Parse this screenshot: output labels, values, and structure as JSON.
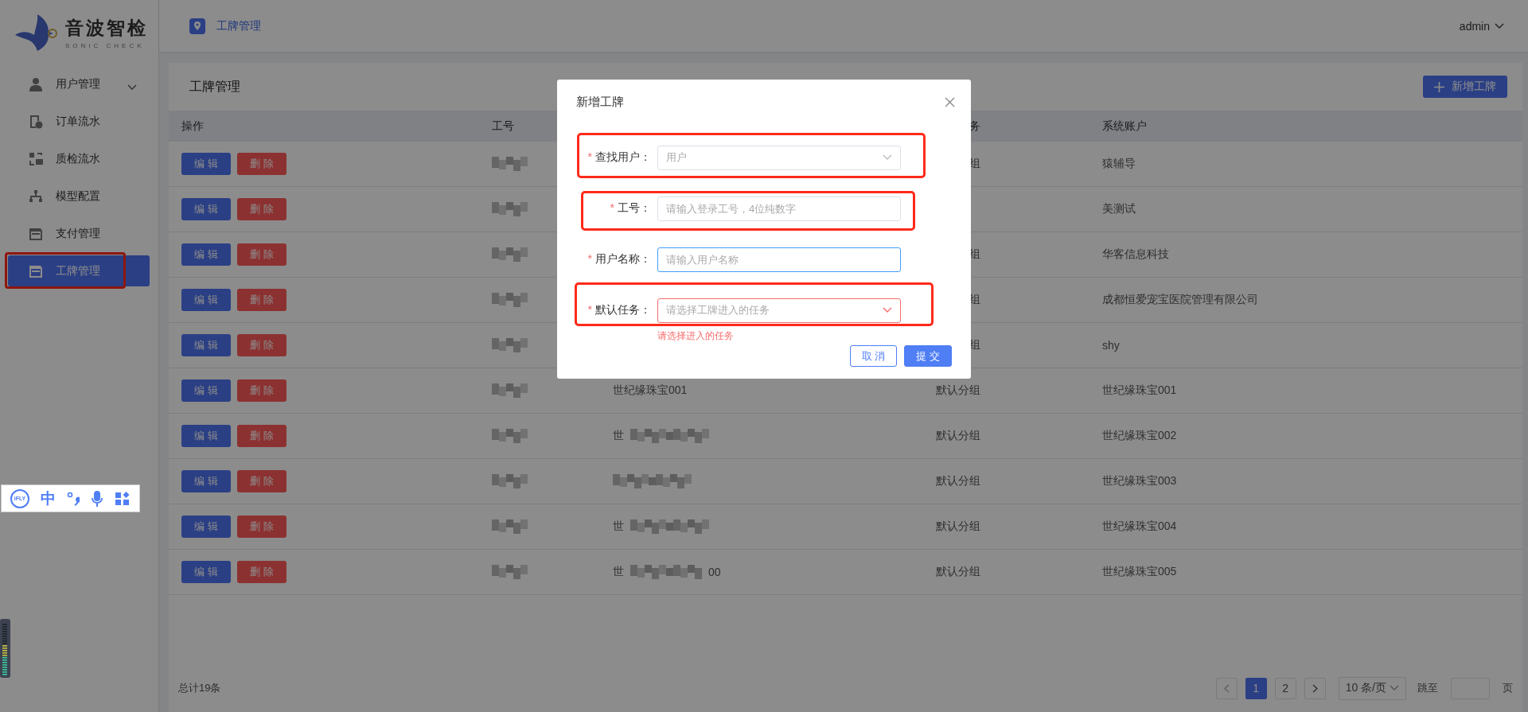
{
  "logo": {
    "name": "音波智检",
    "tagline": "SONIC CHECK"
  },
  "sidebar": {
    "items": [
      {
        "label": "用户管理",
        "kind": "group",
        "expanded": false,
        "selected": false,
        "highlighted": false
      },
      {
        "label": "订单流水",
        "kind": "link",
        "selected": false,
        "highlighted": false
      },
      {
        "label": "质检流水",
        "kind": "link",
        "selected": false,
        "highlighted": false
      },
      {
        "label": "模型配置",
        "kind": "link",
        "selected": false,
        "highlighted": false
      },
      {
        "label": "支付管理",
        "kind": "link",
        "selected": false,
        "highlighted": false
      },
      {
        "label": "工牌管理",
        "kind": "link",
        "selected": true,
        "highlighted": true
      }
    ]
  },
  "header": {
    "breadcrumb": "工牌管理",
    "user": "admin"
  },
  "page": {
    "title": "工牌管理",
    "add_button": "新增工牌"
  },
  "table": {
    "columns": [
      {
        "label": "操作"
      },
      {
        "label": "工号"
      },
      {},
      {
        "label": "务",
        "partial": true
      },
      {
        "label": "系统账户"
      }
    ],
    "rows": [
      {
        "edit": "编 辑",
        "delete": "删 除",
        "column_4": {
          "text": "组",
          "partial": true
        },
        "account": "猿辅导"
      },
      {
        "edit": "编 辑",
        "delete": "删 除",
        "account": "美测试"
      },
      {
        "edit": "编 辑",
        "delete": "删 除",
        "column_4": {
          "text": "组",
          "partial": true
        },
        "account": "华客信息科技"
      },
      {
        "edit": "编 辑",
        "delete": "删 除",
        "column_4": {
          "text": "组",
          "partial": true
        },
        "account": "成都恒爱宠宝医院管理有限公司"
      },
      {
        "edit": "编 辑",
        "delete": "删 除",
        "column_4": {
          "text": "组",
          "partial": true
        },
        "account": "shy"
      },
      {
        "edit": "编 辑",
        "delete": "删 除",
        "column_3": {
          "text": "世纪缘珠宝001",
          "blurred": false
        },
        "column_4": {
          "text": "默认分组"
        },
        "account": "世纪缘珠宝001"
      },
      {
        "edit": "编 辑",
        "delete": "删 除",
        "column_3": {
          "text": "世",
          "blurred": true
        },
        "column_4": {
          "text": "默认分组"
        },
        "account": "世纪缘珠宝002"
      },
      {
        "edit": "编 辑",
        "delete": "删 除",
        "column_3": {
          "blurred": true
        },
        "column_4": {
          "text": "默认分组"
        },
        "account": "世纪缘珠宝003"
      },
      {
        "edit": "编 辑",
        "delete": "删 除",
        "column_3": {
          "text": "世",
          "blurred": true
        },
        "column_4": {
          "text": "默认分组"
        },
        "account": "世纪缘珠宝004"
      },
      {
        "edit": "编 辑",
        "delete": "删 除",
        "column_3": {
          "text": "世",
          "blurred": true,
          "tail": "00"
        },
        "column_4": {
          "text": "默认分组"
        },
        "account": "世纪缘珠宝005"
      }
    ]
  },
  "footer": {
    "total": "总计19条",
    "pages": [
      {
        "label": "1",
        "selected": true
      },
      {
        "label": "2",
        "selected": false
      }
    ],
    "page_size": "10 条/页",
    "jump_label": "跳至",
    "page_unit": "页"
  },
  "dialog": {
    "title": "新增工牌",
    "fields": [
      {
        "asterisk": "*",
        "label": "查找用户：",
        "kind": "select",
        "placeholder": "用户",
        "highlighted": true,
        "focused": false,
        "error": false
      },
      {
        "asterisk": "*",
        "label": "工号：",
        "kind": "input",
        "placeholder": "请输入登录工号，4位纯数字",
        "highlighted": true,
        "focused": false,
        "error": false
      },
      {
        "asterisk": "*",
        "label": "用户名称：",
        "kind": "input",
        "placeholder": "请输入用户名称",
        "highlighted": false,
        "focused": true,
        "error": false
      },
      {
        "asterisk": "*",
        "label": "默认任务：",
        "kind": "select",
        "placeholder": "请选择工牌进入的任务",
        "highlighted": true,
        "focused": false,
        "error": true,
        "error_text": "请选择进入的任务"
      }
    ],
    "buttons": [
      {
        "label": "取 消",
        "kind": "secondary"
      },
      {
        "label": "提 交",
        "kind": "primary"
      }
    ]
  },
  "ime_toolbar": {
    "logo": "iFLY",
    "mode": "中"
  }
}
